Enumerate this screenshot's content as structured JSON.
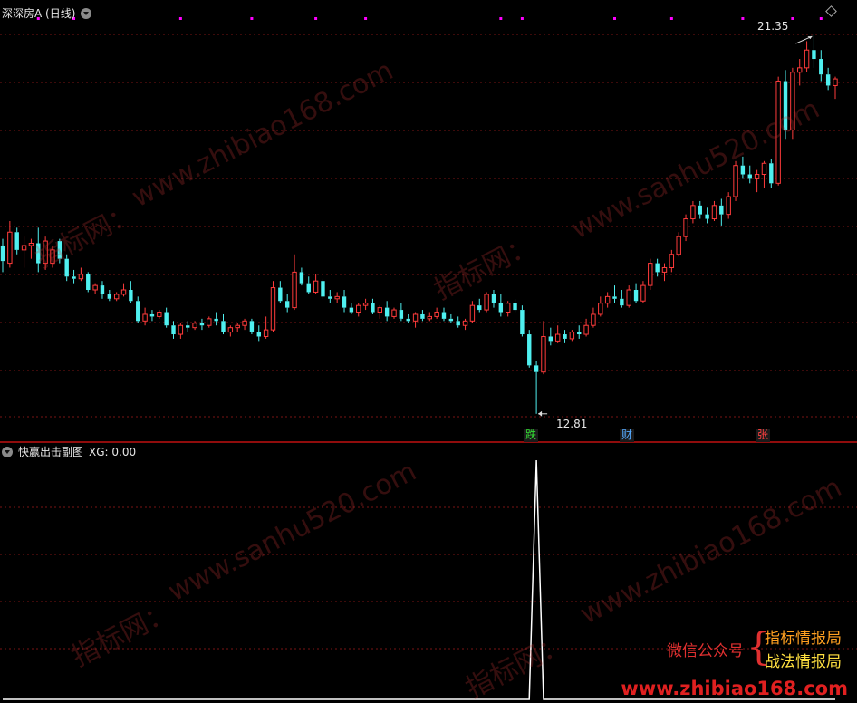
{
  "main_panel": {
    "title": "深深房A (日线)",
    "max_label": "21.35",
    "min_label": "12.81",
    "event_tags": [
      {
        "text": "跌",
        "color": "#33dd33"
      },
      {
        "text": "财",
        "color": "#55aaff"
      },
      {
        "text": "张",
        "color": "#ff4040"
      }
    ]
  },
  "sub_panel": {
    "title": "快赢出击副图",
    "indicator": "XG: 0.00"
  },
  "watermarks": {
    "site_a": "www.zhibiao168.com",
    "site_b": "www.sanhu520.com",
    "cn": "指标网："
  },
  "promo": {
    "left": "微信公众号",
    "line1": "指标情报局",
    "line2": "战法情报局",
    "site": "www.zhibiao168.com"
  },
  "colors": {
    "up": "#ff3b3b",
    "down": "#4ff0f0",
    "grid": "#7a1515",
    "signal_dot": "#ff00ff",
    "divider": "#c01010"
  },
  "chart_data": {
    "type": "candlestick",
    "price_range": [
      12.5,
      21.8
    ],
    "ohlc": [
      [
        16.6,
        16.75,
        16.0,
        16.25
      ],
      [
        16.2,
        17.15,
        16.1,
        16.9
      ],
      [
        16.9,
        17.0,
        16.4,
        16.5
      ],
      [
        16.5,
        16.8,
        16.1,
        16.6
      ],
      [
        16.6,
        16.75,
        16.3,
        16.65
      ],
      [
        16.65,
        17.0,
        16.0,
        16.2
      ],
      [
        16.2,
        16.8,
        16.05,
        16.7
      ],
      [
        16.2,
        16.6,
        16.1,
        16.5
      ],
      [
        16.7,
        16.75,
        16.2,
        16.3
      ],
      [
        16.3,
        16.4,
        15.8,
        15.9
      ],
      [
        15.9,
        16.05,
        15.75,
        15.85
      ],
      [
        15.85,
        16.1,
        15.8,
        15.95
      ],
      [
        15.95,
        16.0,
        15.55,
        15.6
      ],
      [
        15.6,
        15.75,
        15.5,
        15.7
      ],
      [
        15.7,
        15.8,
        15.4,
        15.5
      ],
      [
        15.5,
        15.6,
        15.35,
        15.4
      ],
      [
        15.4,
        15.55,
        15.35,
        15.5
      ],
      [
        15.5,
        15.75,
        15.45,
        15.6
      ],
      [
        15.6,
        15.8,
        15.3,
        15.35
      ],
      [
        15.35,
        15.45,
        14.85,
        14.9
      ],
      [
        14.9,
        15.2,
        14.8,
        15.05
      ],
      [
        15.05,
        15.15,
        14.9,
        15.0
      ],
      [
        15.0,
        15.15,
        14.95,
        15.1
      ],
      [
        15.1,
        15.2,
        14.75,
        14.8
      ],
      [
        14.8,
        14.9,
        14.5,
        14.6
      ],
      [
        14.6,
        14.85,
        14.5,
        14.8
      ],
      [
        14.8,
        14.9,
        14.65,
        14.75
      ],
      [
        14.75,
        14.9,
        14.7,
        14.85
      ],
      [
        14.85,
        14.95,
        14.7,
        14.8
      ],
      [
        14.8,
        15.0,
        14.75,
        14.95
      ],
      [
        14.95,
        15.1,
        14.8,
        14.9
      ],
      [
        14.9,
        15.05,
        14.6,
        14.65
      ],
      [
        14.65,
        14.8,
        14.55,
        14.75
      ],
      [
        14.75,
        14.85,
        14.65,
        14.8
      ],
      [
        14.8,
        14.95,
        14.7,
        14.9
      ],
      [
        14.9,
        14.95,
        14.6,
        14.65
      ],
      [
        14.65,
        14.8,
        14.45,
        14.55
      ],
      [
        14.55,
        15.0,
        14.5,
        14.7
      ],
      [
        14.7,
        15.8,
        14.65,
        15.65
      ],
      [
        15.65,
        15.8,
        15.3,
        15.35
      ],
      [
        15.35,
        15.5,
        15.1,
        15.2
      ],
      [
        15.2,
        16.4,
        15.15,
        16.0
      ],
      [
        16.0,
        16.1,
        15.7,
        15.75
      ],
      [
        15.75,
        15.9,
        15.5,
        15.55
      ],
      [
        15.55,
        15.95,
        15.5,
        15.8
      ],
      [
        15.8,
        15.85,
        15.4,
        15.45
      ],
      [
        15.45,
        15.6,
        15.3,
        15.4
      ],
      [
        15.4,
        15.55,
        15.3,
        15.45
      ],
      [
        15.45,
        15.6,
        15.1,
        15.2
      ],
      [
        15.2,
        15.3,
        15.05,
        15.1
      ],
      [
        15.1,
        15.3,
        15.0,
        15.25
      ],
      [
        15.25,
        15.4,
        15.15,
        15.3
      ],
      [
        15.3,
        15.4,
        15.05,
        15.1
      ],
      [
        15.1,
        15.25,
        14.95,
        15.2
      ],
      [
        15.2,
        15.35,
        14.9,
        15.0
      ],
      [
        15.0,
        15.2,
        14.95,
        15.15
      ],
      [
        15.15,
        15.3,
        14.9,
        14.95
      ],
      [
        14.95,
        15.05,
        14.85,
        14.9
      ],
      [
        14.9,
        15.1,
        14.75,
        15.05
      ],
      [
        15.05,
        15.15,
        14.9,
        14.95
      ],
      [
        14.95,
        15.1,
        14.9,
        15.0
      ],
      [
        15.0,
        15.2,
        14.95,
        15.1
      ],
      [
        15.1,
        15.2,
        14.9,
        14.95
      ],
      [
        14.95,
        15.05,
        14.85,
        14.9
      ],
      [
        14.9,
        15.0,
        14.75,
        14.8
      ],
      [
        14.8,
        14.95,
        14.7,
        14.9
      ],
      [
        14.9,
        15.35,
        14.85,
        15.25
      ],
      [
        15.25,
        15.4,
        15.1,
        15.15
      ],
      [
        15.15,
        15.55,
        15.1,
        15.5
      ],
      [
        15.5,
        15.6,
        15.2,
        15.3
      ],
      [
        15.3,
        15.5,
        15.0,
        15.1
      ],
      [
        15.1,
        15.35,
        15.0,
        15.3
      ],
      [
        15.3,
        15.4,
        15.1,
        15.15
      ],
      [
        15.15,
        15.25,
        14.55,
        14.6
      ],
      [
        14.6,
        14.7,
        13.85,
        13.9
      ],
      [
        13.9,
        14.0,
        12.81,
        13.75
      ],
      [
        13.75,
        14.9,
        13.7,
        14.55
      ],
      [
        14.55,
        14.75,
        14.35,
        14.45
      ],
      [
        14.45,
        14.8,
        14.4,
        14.6
      ],
      [
        14.6,
        14.7,
        14.4,
        14.5
      ],
      [
        14.5,
        14.7,
        14.45,
        14.65
      ],
      [
        14.65,
        14.8,
        14.5,
        14.6
      ],
      [
        14.6,
        14.95,
        14.55,
        14.8
      ],
      [
        14.8,
        15.2,
        14.75,
        15.05
      ],
      [
        15.05,
        15.45,
        15.0,
        15.3
      ],
      [
        15.3,
        15.55,
        15.2,
        15.45
      ],
      [
        15.45,
        15.7,
        15.3,
        15.4
      ],
      [
        15.4,
        15.6,
        15.2,
        15.25
      ],
      [
        15.25,
        15.7,
        15.2,
        15.6
      ],
      [
        15.6,
        15.75,
        15.3,
        15.35
      ],
      [
        15.35,
        15.8,
        15.3,
        15.7
      ],
      [
        15.7,
        16.3,
        15.6,
        16.2
      ],
      [
        16.2,
        16.3,
        15.9,
        16.0
      ],
      [
        16.0,
        16.2,
        15.8,
        16.1
      ],
      [
        16.1,
        16.5,
        16.0,
        16.4
      ],
      [
        16.4,
        16.9,
        16.35,
        16.8
      ],
      [
        16.8,
        17.3,
        16.7,
        17.2
      ],
      [
        17.2,
        17.6,
        17.1,
        17.5
      ],
      [
        17.5,
        17.6,
        17.2,
        17.3
      ],
      [
        17.3,
        17.45,
        17.1,
        17.2
      ],
      [
        17.2,
        17.6,
        17.15,
        17.5
      ],
      [
        17.5,
        17.65,
        17.05,
        17.3
      ],
      [
        17.3,
        17.8,
        17.2,
        17.7
      ],
      [
        17.7,
        18.5,
        17.6,
        18.4
      ],
      [
        18.4,
        18.6,
        18.1,
        18.2
      ],
      [
        18.2,
        18.4,
        18.0,
        18.1
      ],
      [
        18.1,
        18.3,
        17.8,
        18.2
      ],
      [
        18.2,
        18.5,
        17.9,
        18.45
      ],
      [
        18.45,
        18.55,
        17.9,
        18.0
      ],
      [
        18.0,
        20.4,
        17.95,
        20.3
      ],
      [
        20.3,
        20.55,
        19.0,
        19.2
      ],
      [
        19.2,
        20.6,
        19.0,
        20.5
      ],
      [
        20.5,
        20.8,
        20.2,
        20.6
      ],
      [
        20.6,
        21.2,
        20.5,
        21.0
      ],
      [
        21.0,
        21.35,
        20.6,
        20.8
      ],
      [
        20.8,
        21.0,
        20.3,
        20.45
      ],
      [
        20.45,
        20.6,
        20.1,
        20.2
      ],
      [
        20.2,
        20.4,
        19.9,
        20.35
      ]
    ],
    "signal_xg": {
      "peak_value": 1,
      "peak_index": 75,
      "current": 0.0
    },
    "signal_dot_indices": [
      5,
      10,
      25,
      35,
      44,
      51,
      70,
      73,
      86,
      94,
      104,
      111,
      115
    ]
  }
}
